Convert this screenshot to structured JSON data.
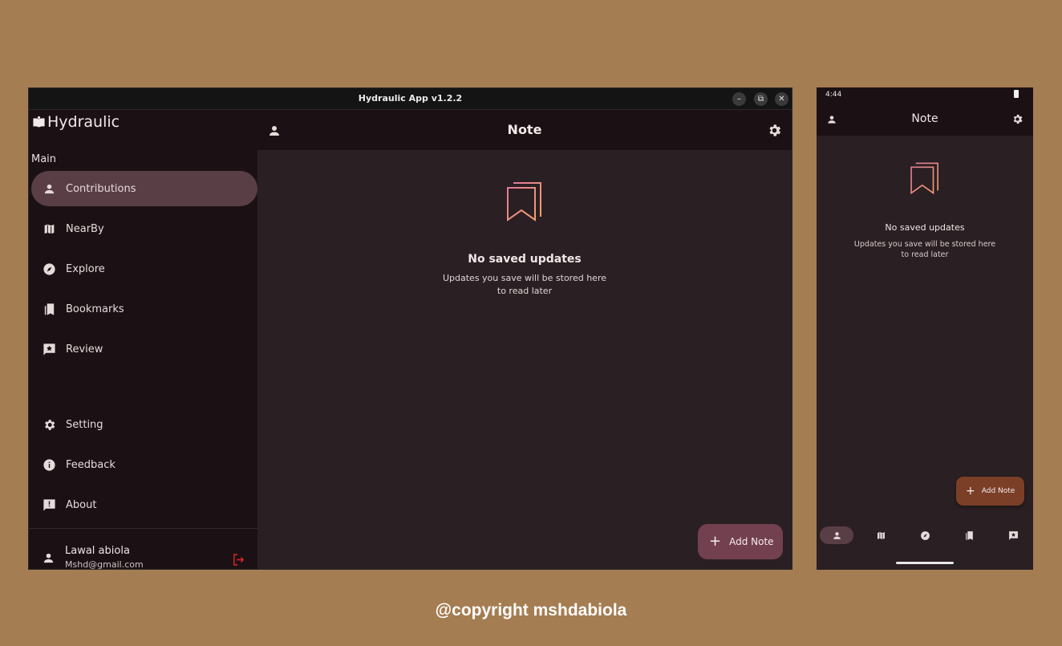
{
  "window": {
    "title": "Hydraulic App v1.2.2",
    "minimize_glyph": "–",
    "restore_glyph": "⧉",
    "close_glyph": "✕"
  },
  "sidebar": {
    "brand": "Hydraulic",
    "section_label": "Main",
    "items": [
      {
        "label": "Contributions",
        "icon": "person-icon",
        "active": true
      },
      {
        "label": "NearBy",
        "icon": "map-icon"
      },
      {
        "label": "Explore",
        "icon": "compass-icon"
      },
      {
        "label": "Bookmarks",
        "icon": "bookmarks-icon"
      },
      {
        "label": "Review",
        "icon": "rate-review-icon"
      }
    ],
    "footer_items": [
      {
        "label": "Setting",
        "icon": "gear-icon"
      },
      {
        "label": "Feedback",
        "icon": "info-icon"
      },
      {
        "label": "About",
        "icon": "feedback-icon"
      }
    ],
    "user": {
      "name": "Lawal abiola",
      "email": "Mshd@gmail.com"
    }
  },
  "main": {
    "title": "Note",
    "empty_title": "No saved updates",
    "empty_text": "Updates you save will be stored here to read later",
    "fab_label": "Add Note"
  },
  "phone": {
    "time": "4:44",
    "title": "Note",
    "empty_title": "No saved updates",
    "empty_text": "Updates you save will be stored here to read later",
    "fab_label": "Add Note"
  },
  "colors": {
    "background": "#a57d52",
    "accent": "#73404f",
    "active_item": "#5a3e45",
    "logout": "#e0242b",
    "bookmark_gradient": [
      "#e07a9a",
      "#f3a070"
    ]
  },
  "copyright": "@copyright mshdabiola"
}
